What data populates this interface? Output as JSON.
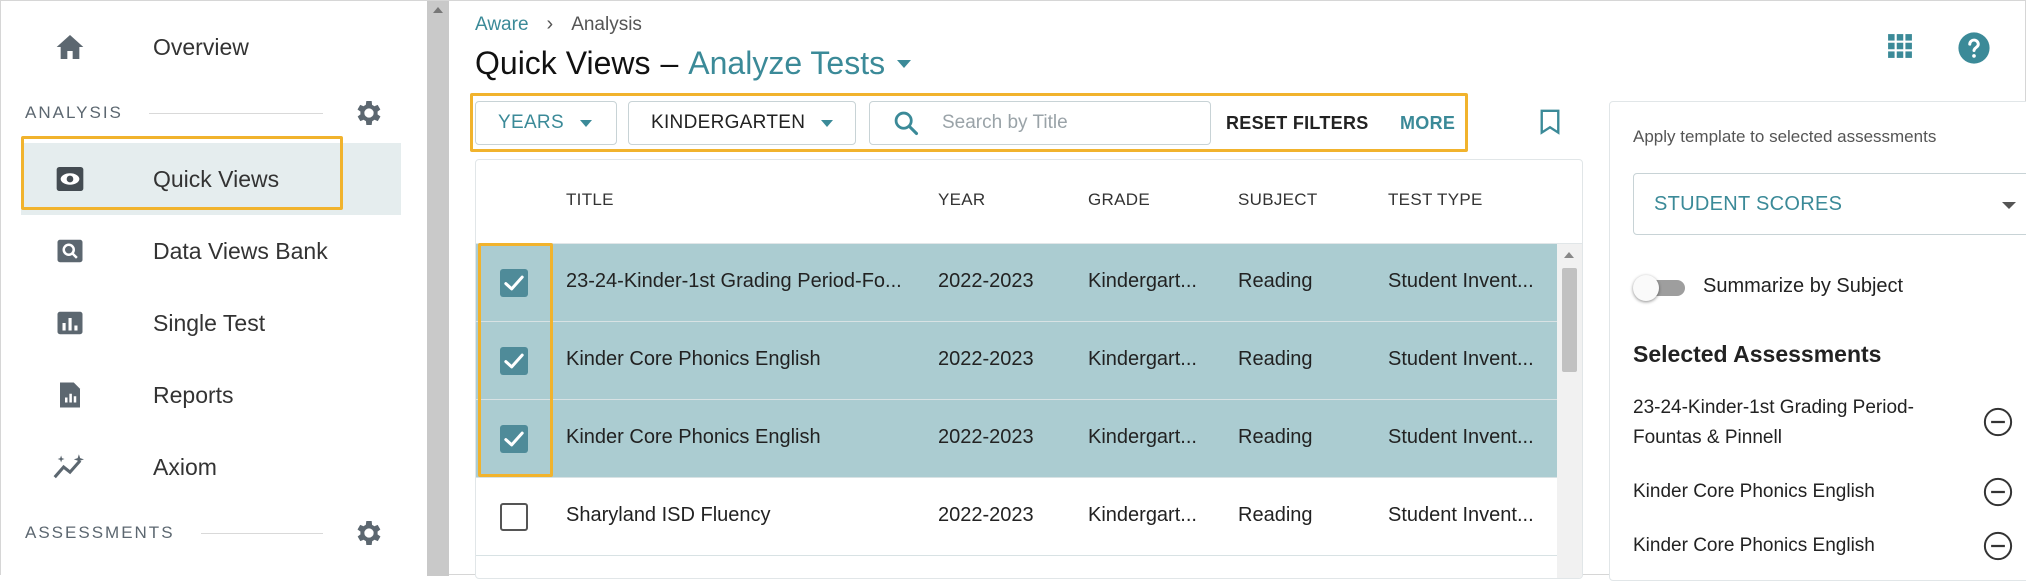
{
  "breadcrumb": {
    "root": "Aware",
    "current": "Analysis"
  },
  "page": {
    "title": "Quick Views",
    "separator": "–",
    "subtitle": "Analyze Tests"
  },
  "sidebar": {
    "items": [
      {
        "label": "Overview",
        "icon": "home-icon"
      },
      {
        "label": "Quick Views",
        "icon": "eye-icon",
        "selected": true
      },
      {
        "label": "Data Views Bank",
        "icon": "search-doc-icon"
      },
      {
        "label": "Single Test",
        "icon": "bar-chart-icon"
      },
      {
        "label": "Reports",
        "icon": "report-icon"
      },
      {
        "label": "Axiom",
        "icon": "sparkle-chart-icon"
      }
    ],
    "sections": {
      "analysis": "ANALYSIS",
      "assessments": "ASSESSMENTS"
    }
  },
  "filters": {
    "years_label": "YEARS",
    "grade_label": "KINDERGARTEN",
    "search_placeholder": "Search by Title",
    "reset_label": "RESET FILTERS",
    "more_label": "MORE"
  },
  "table": {
    "columns": {
      "title": "TITLE",
      "year": "YEAR",
      "grade": "GRADE",
      "subject": "SUBJECT",
      "test_type": "TEST TYPE"
    },
    "rows": [
      {
        "checked": true,
        "title": "23-24-Kinder-1st Grading Period-Fo...",
        "year": "2022-2023",
        "grade": "Kindergart...",
        "subject": "Reading",
        "test_type": "Student Invent..."
      },
      {
        "checked": true,
        "title": "Kinder Core Phonics English",
        "year": "2022-2023",
        "grade": "Kindergart...",
        "subject": "Reading",
        "test_type": "Student Invent..."
      },
      {
        "checked": true,
        "title": "Kinder Core Phonics English",
        "year": "2022-2023",
        "grade": "Kindergart...",
        "subject": "Reading",
        "test_type": "Student Invent..."
      },
      {
        "checked": false,
        "title": "Sharyland ISD Fluency",
        "year": "2022-2023",
        "grade": "Kindergart...",
        "subject": "Reading",
        "test_type": "Student Invent..."
      }
    ]
  },
  "panel": {
    "apply_label": "Apply template to selected assessments",
    "template_value": "STUDENT SCORES",
    "summarize_label": "Summarize by Subject",
    "summarize_on": false,
    "selected_heading": "Selected Assessments",
    "selected": [
      {
        "line1": "23-24-Kinder-1st Grading Period-",
        "line2": "Fountas & Pinnell"
      },
      {
        "line1": "Kinder Core Phonics English",
        "line2": ""
      },
      {
        "line1": "Kinder Core Phonics English",
        "line2": ""
      }
    ]
  },
  "colors": {
    "accent": "#3b8a98",
    "highlight": "#f1b32d",
    "selected_row": "#abccd1",
    "checkbox": "#4f8b99"
  }
}
